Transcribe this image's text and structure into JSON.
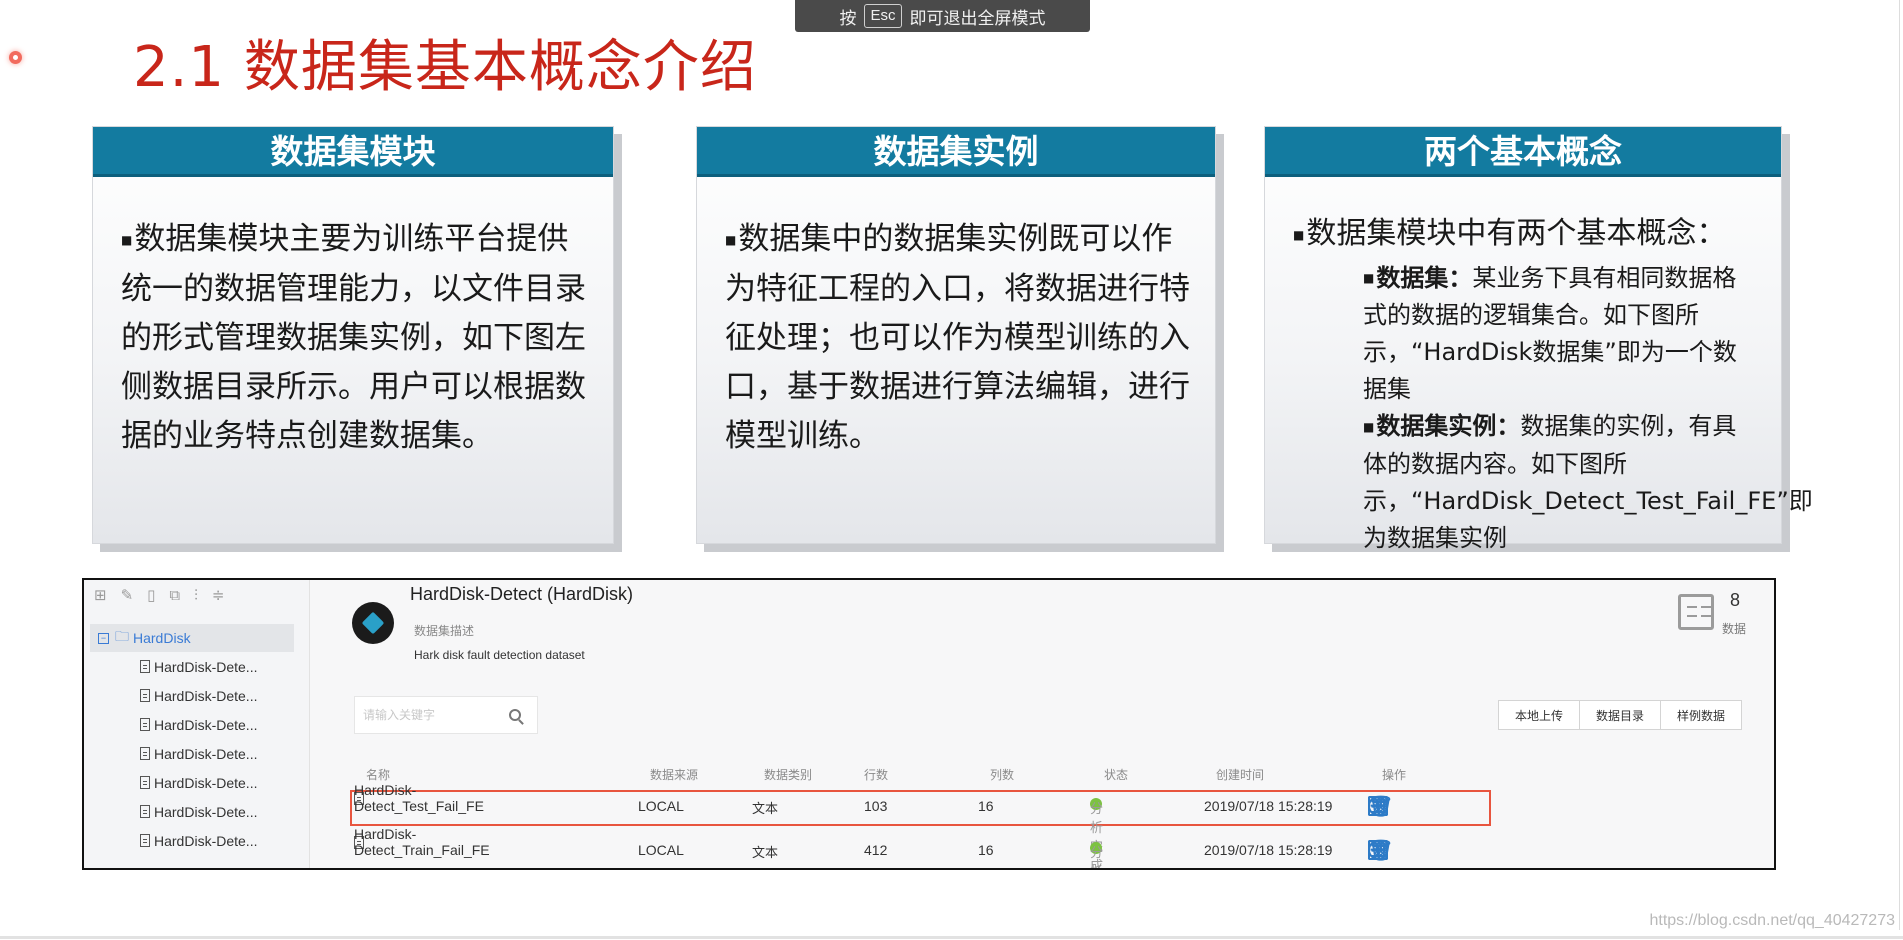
{
  "banner": {
    "pre": "按",
    "key": "Esc",
    "post": "即可退出全屏模式"
  },
  "slide": {
    "title": "2.1 数据集基本概念介绍"
  },
  "cards": [
    {
      "title": "数据集模块",
      "text": "数据集模块主要为训练平台提供统一的数据管理能力，以文件目录的形式管理数据集实例，如下图左侧数据目录所示。用户可以根据数据的业务特点创建数据集。"
    },
    {
      "title": "数据集实例",
      "text": "数据集中的数据集实例既可以作为特征工程的入口，将数据进行特征处理；也可以作为模型训练的入口，基于数据进行算法编辑，进行模型训练。"
    },
    {
      "title": "两个基本概念",
      "lead": "数据集模块中有两个基本概念：",
      "item1_term": "数据集：",
      "item1_text": "某业务下具有相同数据格式的数据的逻辑集合。如下图所示，“HardDisk数据集”即为一个数据集",
      "item2_term": "数据集实例：",
      "item2_text": "数据集的实例，有具体的数据内容。如下图所示，“HardDisk_Detect_Test_Fail_FE”即为数据集实例"
    }
  ],
  "app": {
    "tree_root": "HardDisk",
    "tree_items": [
      "HardDisk-Dete...",
      "HardDisk-Dete...",
      "HardDisk-Dete...",
      "HardDisk-Dete...",
      "HardDisk-Dete...",
      "HardDisk-Dete...",
      "HardDisk-Dete..."
    ],
    "dataset_title": "HardDisk-Detect (HardDisk)",
    "desc_label": "数据集描述",
    "desc": "Hark disk fault detection dataset",
    "count": "8",
    "count_label": "数据",
    "search_placeholder": "请输入关键字",
    "buttons": [
      "本地上传",
      "数据目录",
      "样例数据"
    ],
    "columns": [
      "名称",
      "数据来源",
      "数据类别",
      "行数",
      "列数",
      "状态",
      "创建时间",
      "操作"
    ],
    "rows": [
      {
        "name": "HardDisk-Detect_Test_Fail_FE",
        "source": "LOCAL",
        "type": "文本",
        "rows": "103",
        "cols": "16",
        "status": "分析完成",
        "created": "2019/07/18 15:28:19"
      },
      {
        "name": "HardDisk-Detect_Train_Fail_FE",
        "source": "LOCAL",
        "type": "文本",
        "rows": "412",
        "cols": "16",
        "status": "分析完成",
        "created": "2019/07/18 15:28:19"
      }
    ],
    "status_color": "#7dc242",
    "accent_color": "#2d7bc7"
  },
  "watermark": "https://blog.csdn.net/qq_40427273"
}
